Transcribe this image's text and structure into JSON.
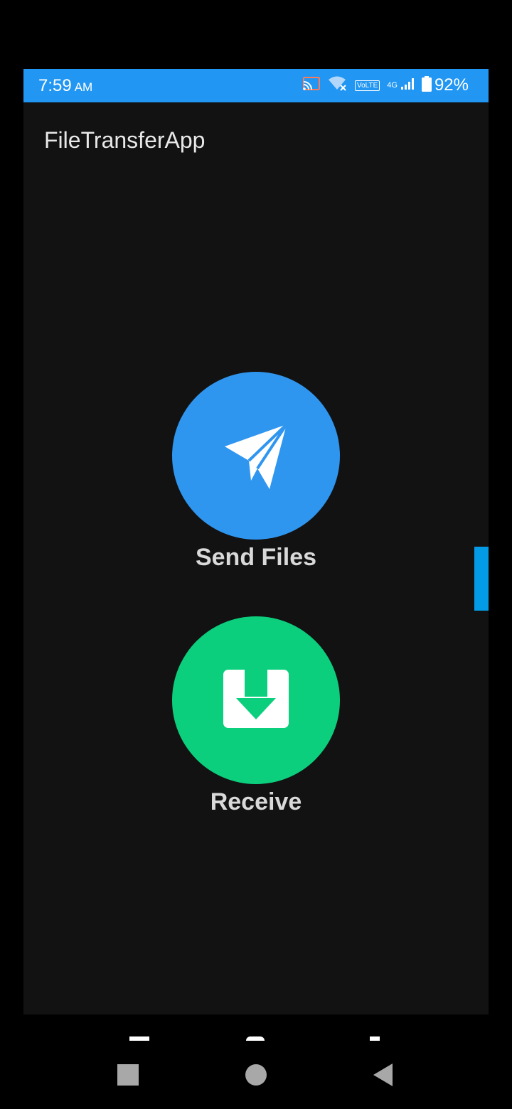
{
  "status_bar": {
    "time": "7:59",
    "ampm": "AM",
    "network_badge": "VoLTE",
    "network_type": "4G",
    "battery_percent": "92%",
    "color": "#2196f3"
  },
  "app": {
    "title": "FileTransferApp"
  },
  "actions": {
    "send": {
      "label": "Send Files",
      "icon": "paper-plane-icon",
      "color": "#2f96f0"
    },
    "receive": {
      "label": "Receive",
      "icon": "download-tray-icon",
      "color": "#0ccf7e"
    }
  },
  "nav_bar": {
    "buttons": [
      "recents-square-icon",
      "home-circle-icon",
      "back-triangle-icon"
    ]
  }
}
